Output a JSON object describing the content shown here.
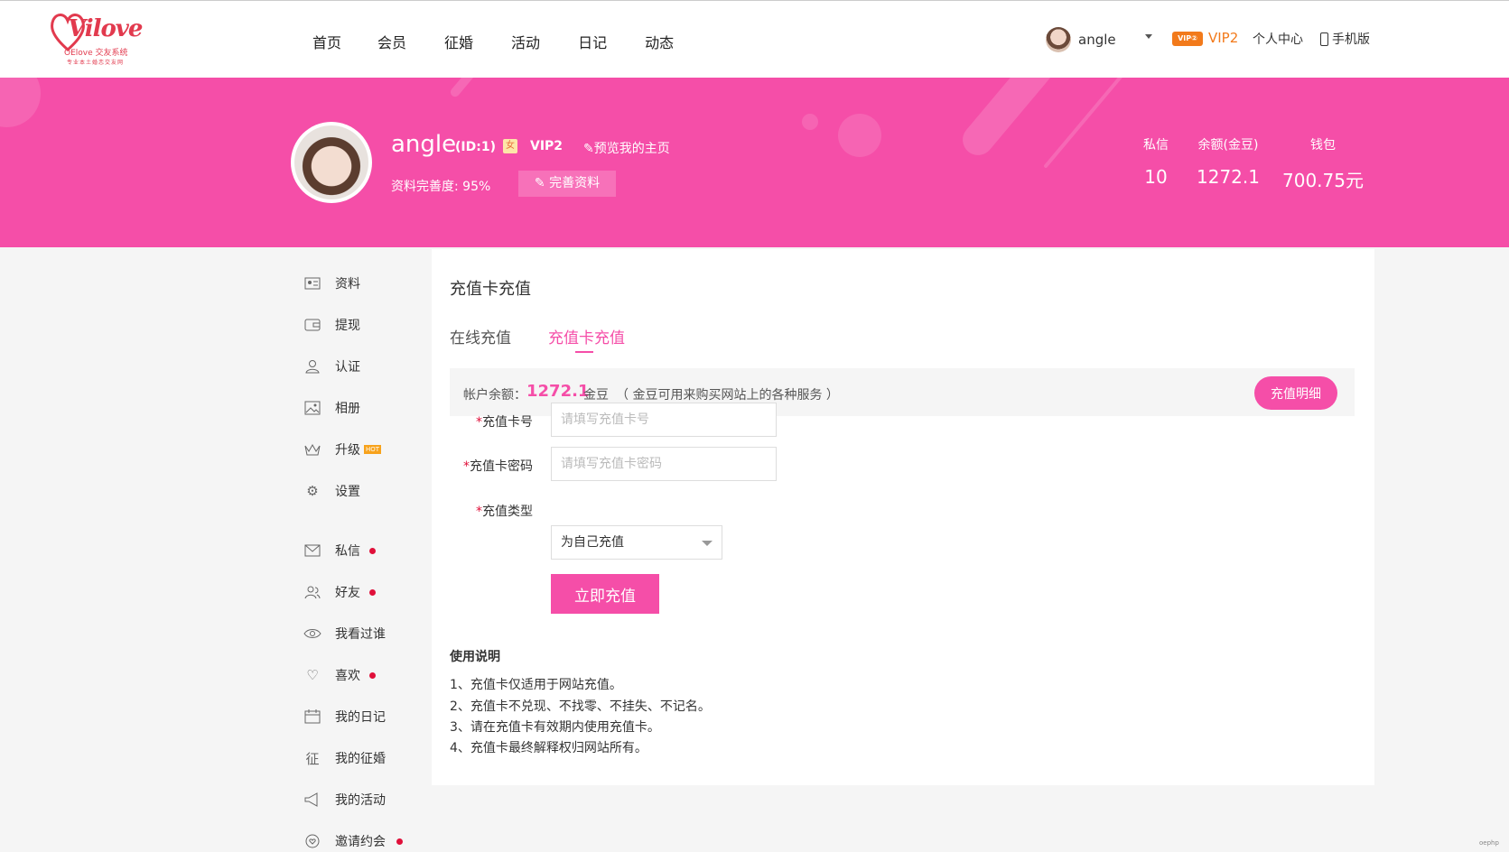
{
  "header": {
    "logo": {
      "script": "Vilove",
      "sub1": "OElove 交友系统",
      "sub2": "专业本土婚恋交友网"
    },
    "nav": [
      "首页",
      "会员",
      "征婚",
      "活动",
      "日记",
      "动态"
    ],
    "user": {
      "name": "angle",
      "vip_badge": "VIP②",
      "vip_level": "VIP2",
      "center": "个人中心",
      "mobile": "手机版"
    }
  },
  "profile": {
    "name": "angle",
    "id": "(ID:1)",
    "gender_badge": "女",
    "vip": "VIP2",
    "preview": "预览我的主页",
    "completion": "资料完善度: 95%",
    "complete_btn": "完善资料",
    "stats": [
      {
        "label": "私信",
        "value": "10"
      },
      {
        "label": "余额(金豆)",
        "value": "1272.1"
      },
      {
        "label": "钱包",
        "value": "700.75元"
      }
    ]
  },
  "sidebar": {
    "items": [
      {
        "label": "资料",
        "icon": "id-card-icon"
      },
      {
        "label": "提现",
        "icon": "wallet-icon"
      },
      {
        "label": "认证",
        "icon": "user-verify-icon"
      },
      {
        "label": "相册",
        "icon": "image-icon"
      },
      {
        "label": "升级",
        "icon": "crown-icon",
        "badge": "HOT"
      },
      {
        "label": "设置",
        "icon": "gear-icon"
      },
      {
        "label": "私信",
        "icon": "mail-icon",
        "dot": true
      },
      {
        "label": "好友",
        "icon": "friends-icon",
        "dot": true
      },
      {
        "label": "我看过谁",
        "icon": "eye-icon"
      },
      {
        "label": "喜欢",
        "icon": "heart-icon",
        "dot": true
      },
      {
        "label": "我的日记",
        "icon": "calendar-icon"
      },
      {
        "label": "我的征婚",
        "icon": "zheng-icon"
      },
      {
        "label": "我的活动",
        "icon": "megaphone-icon"
      },
      {
        "label": "邀请约会",
        "icon": "chat-heart-icon",
        "dot": true
      }
    ]
  },
  "main": {
    "title": "充值卡充值",
    "tabs": [
      {
        "label": "在线充值"
      },
      {
        "label": "充值卡充值",
        "active": true
      }
    ],
    "balance": {
      "label": "帐户余额：",
      "value": "1272.1",
      "unit": "金豆",
      "note": "（ 金豆可用来购买网站上的各种服务 ）",
      "detail_btn": "充值明细"
    },
    "form": {
      "card_no": {
        "label": "充值卡号",
        "placeholder": "请填写充值卡号"
      },
      "card_pwd": {
        "label": "充值卡密码",
        "placeholder": "请填写充值卡密码"
      },
      "type": {
        "label": "充值类型",
        "selected": "为自己充值"
      },
      "submit": "立即充值"
    },
    "usage": {
      "title": "使用说明",
      "items": [
        "1、充值卡仅适用于网站充值。",
        "2、充值卡不兑现、不找零、不挂失、不记名。",
        "3、请在充值卡有效期内使用充值卡。",
        "4、充值卡最终解释权归网站所有。"
      ]
    }
  },
  "watermark": "oephp"
}
